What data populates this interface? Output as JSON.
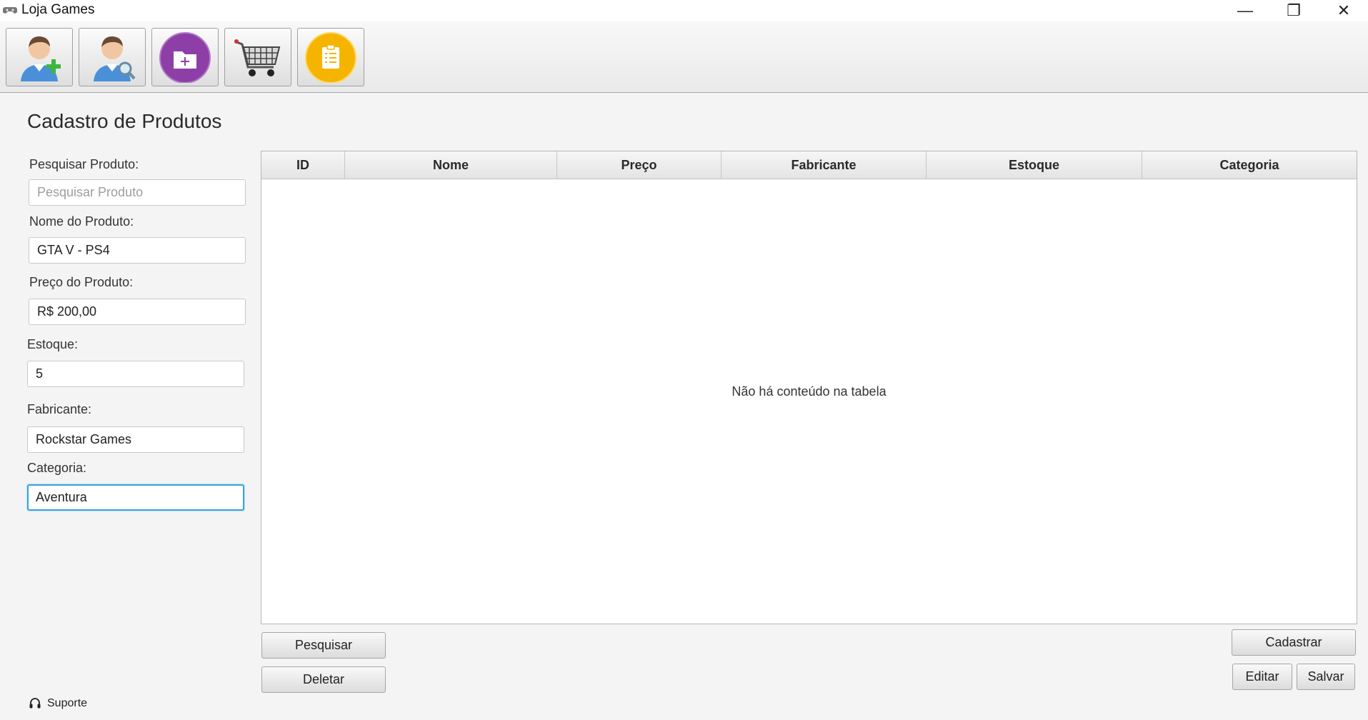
{
  "window": {
    "title": "Loja Games",
    "controls": {
      "minimize": "—",
      "maximize": "❐",
      "close": "✕"
    }
  },
  "toolbar": {
    "buttons": [
      {
        "icon": "add-user-icon"
      },
      {
        "icon": "search-user-icon"
      },
      {
        "icon": "add-folder-icon",
        "color": "#8e3ea7"
      },
      {
        "icon": "shopping-cart-icon"
      },
      {
        "icon": "clipboard-icon",
        "color": "#f5b400"
      }
    ]
  },
  "page": {
    "title": "Cadastro de Produtos"
  },
  "form": {
    "search_label": "Pesquisar Produto:",
    "search_placeholder": "Pesquisar Produto",
    "search_value": "",
    "name_label": "Nome do Produto:",
    "name_value": "GTA V - PS4",
    "price_label": "Preço do Produto:",
    "price_value": "R$ 200,00",
    "stock_label": "Estoque:",
    "stock_value": "5",
    "maker_label": "Fabricante:",
    "maker_value": "Rockstar Games",
    "category_label": "Categoria:",
    "category_value": "Aventura"
  },
  "table": {
    "columns": [
      "ID",
      "Nome",
      "Preço",
      "Fabricante",
      "Estoque",
      "Categoria"
    ],
    "rows": [],
    "empty_message": "Não há conteúdo na tabela"
  },
  "actions": {
    "search": "Pesquisar",
    "delete": "Deletar",
    "register": "Cadastrar",
    "edit": "Editar",
    "save": "Salvar"
  },
  "footer": {
    "support_label": "Suporte",
    "support_icon": "headset-icon"
  },
  "colors": {
    "focus": "#3ba4d6",
    "purple": "#8e3ea7",
    "yellow": "#f5b400",
    "green": "#3fb63f"
  }
}
